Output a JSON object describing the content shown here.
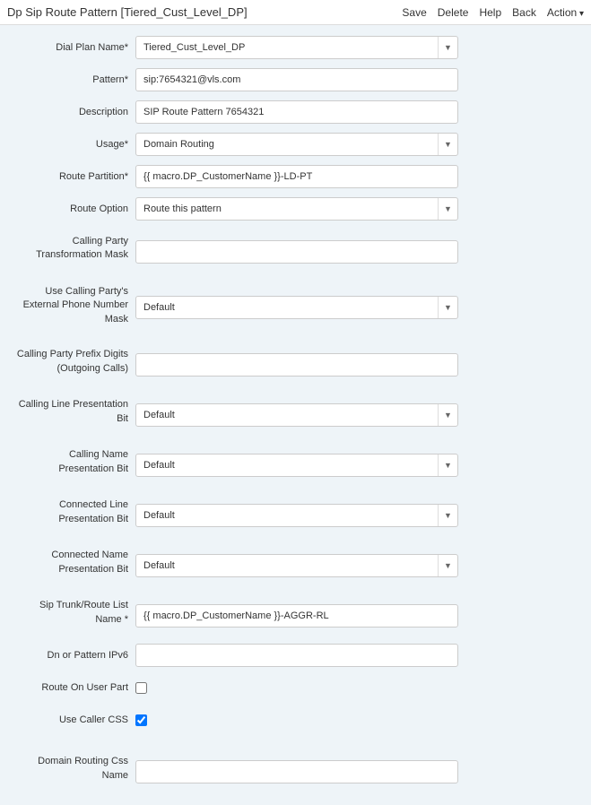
{
  "header": {
    "title": "Dp Sip Route Pattern [Tiered_Cust_Level_DP]",
    "actions": {
      "save": "Save",
      "delete": "Delete",
      "help": "Help",
      "back": "Back",
      "action": "Action"
    }
  },
  "form": {
    "dial_plan_name": {
      "label": "Dial Plan Name*",
      "value": "Tiered_Cust_Level_DP"
    },
    "pattern": {
      "label": "Pattern*",
      "value": "sip:7654321@vls.com"
    },
    "description": {
      "label": "Description",
      "value": "SIP Route Pattern 7654321"
    },
    "usage": {
      "label": "Usage*",
      "value": "Domain Routing"
    },
    "route_partition": {
      "label": "Route Partition*",
      "value": "{{ macro.DP_CustomerName }}-LD-PT"
    },
    "route_option": {
      "label": "Route Option",
      "value": "Route this pattern"
    },
    "calling_party_transformation_mask": {
      "label": "Calling Party Transformation Mask",
      "value": ""
    },
    "use_calling_party_external_mask": {
      "label": "Use Calling Party's External Phone Number Mask",
      "value": "Default"
    },
    "calling_party_prefix_digits": {
      "label": "Calling Party Prefix Digits (Outgoing Calls)",
      "value": ""
    },
    "calling_line_presentation_bit": {
      "label": "Calling Line Presentation Bit",
      "value": "Default"
    },
    "calling_name_presentation_bit": {
      "label": "Calling Name Presentation Bit",
      "value": "Default"
    },
    "connected_line_presentation_bit": {
      "label": "Connected Line Presentation Bit",
      "value": "Default"
    },
    "connected_name_presentation_bit": {
      "label": "Connected Name Presentation Bit",
      "value": "Default"
    },
    "sip_trunk_route_list_name": {
      "label": "Sip Trunk/Route List Name *",
      "value": "{{ macro.DP_CustomerName }}-AGGR-RL"
    },
    "dn_or_pattern_ipv6": {
      "label": "Dn or Pattern IPv6",
      "value": ""
    },
    "route_on_user_part": {
      "label": "Route On User Part",
      "checked": false
    },
    "use_caller_css": {
      "label": "Use Caller CSS",
      "checked": true
    },
    "domain_routing_css_name": {
      "label": "Domain Routing Css Name",
      "value": ""
    }
  }
}
